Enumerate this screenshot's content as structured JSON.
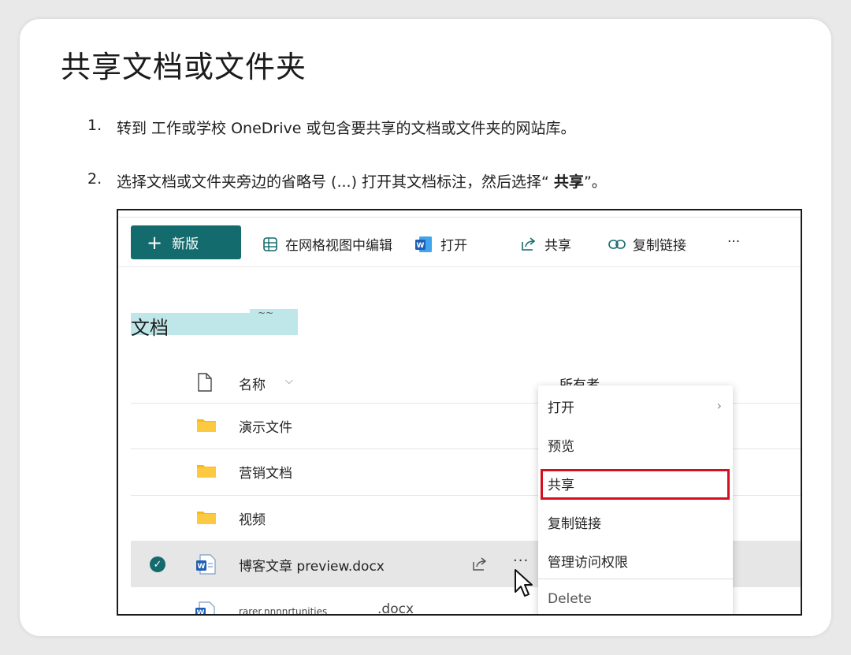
{
  "page": {
    "title": "共享文档或文件夹",
    "steps": [
      {
        "num": "1.",
        "text": "转到 工作或学校 OneDrive 或包含要共享的文档或文件夹的网站库。"
      },
      {
        "num": "2.",
        "text_before": "选择文档或文件夹旁边的省略号 (...) 打开其文档标注，然后选择“ ",
        "text_bold": "共享",
        "text_after": "”。"
      }
    ]
  },
  "screenshot": {
    "toolbar": {
      "new_label": "新版",
      "new_plus": "+",
      "grid_edit": "在网格视图中编辑",
      "open": "打开",
      "share": "共享",
      "copy_link": "复制链接",
      "more": "···"
    },
    "library_title": "文档",
    "library_mark": "~~",
    "columns": {
      "name": "名称",
      "sort": "⌵",
      "owner": "所有者"
    },
    "rows": [
      {
        "name": "演示文件",
        "type": "folder"
      },
      {
        "name": "营销文档",
        "type": "folder"
      },
      {
        "name": "视频",
        "type": "folder"
      },
      {
        "name": "博客文章 preview.docx",
        "type": "word",
        "selected": true
      }
    ],
    "row_actions": {
      "more": "···"
    },
    "last_row": {
      "name": "rarer.nnnnrtunities",
      "ext": ".docx"
    },
    "context_menu": {
      "items": [
        "打开",
        "预览",
        "共享",
        "复制链接",
        "管理访问权限",
        "Delete"
      ],
      "submenu_arrow": "›",
      "highlighted": "共享"
    },
    "colors": {
      "accent": "#146b6d",
      "highlight_box": "#d4101f",
      "folder": "#f6b81b",
      "word": "#1f5fb5"
    }
  }
}
